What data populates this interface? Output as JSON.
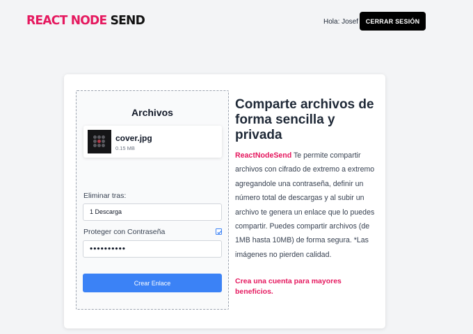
{
  "header": {
    "logo_part1": "REACT NODE",
    "logo_part2": "SEND",
    "greeting": "Hola: Josef",
    "logout_label": "CERRAR SESIÓN"
  },
  "upload": {
    "title": "Archivos",
    "file": {
      "name": "cover.jpg",
      "size": "0.15 MB"
    },
    "delete_after_label": "Eliminar tras:",
    "delete_after_value": "1 Descarga",
    "protect_label": "Proteger con Contraseña",
    "protect_checked": true,
    "password_value": "••••••••••",
    "create_button": "Crear Enlace"
  },
  "info": {
    "heading": "Comparte archivos de forma sencilla y privada",
    "brand": "ReactNodeSend",
    "description": " Te permite compartir archivos con cifrado de extremo a extremo agregandole una contraseña, definir un número total de descargas y al subir un archivo te genera un enlace que lo puedes compartir. Puedes compartir archivos (de 1MB hasta 10MB) de forma segura. *Las imágenes no pierden calidad.",
    "cta": "Crea una cuenta para mayores beneficios."
  },
  "colors": {
    "brand": "#e5195f",
    "primary_button": "#3b82f6",
    "dark_button": "#000000"
  }
}
